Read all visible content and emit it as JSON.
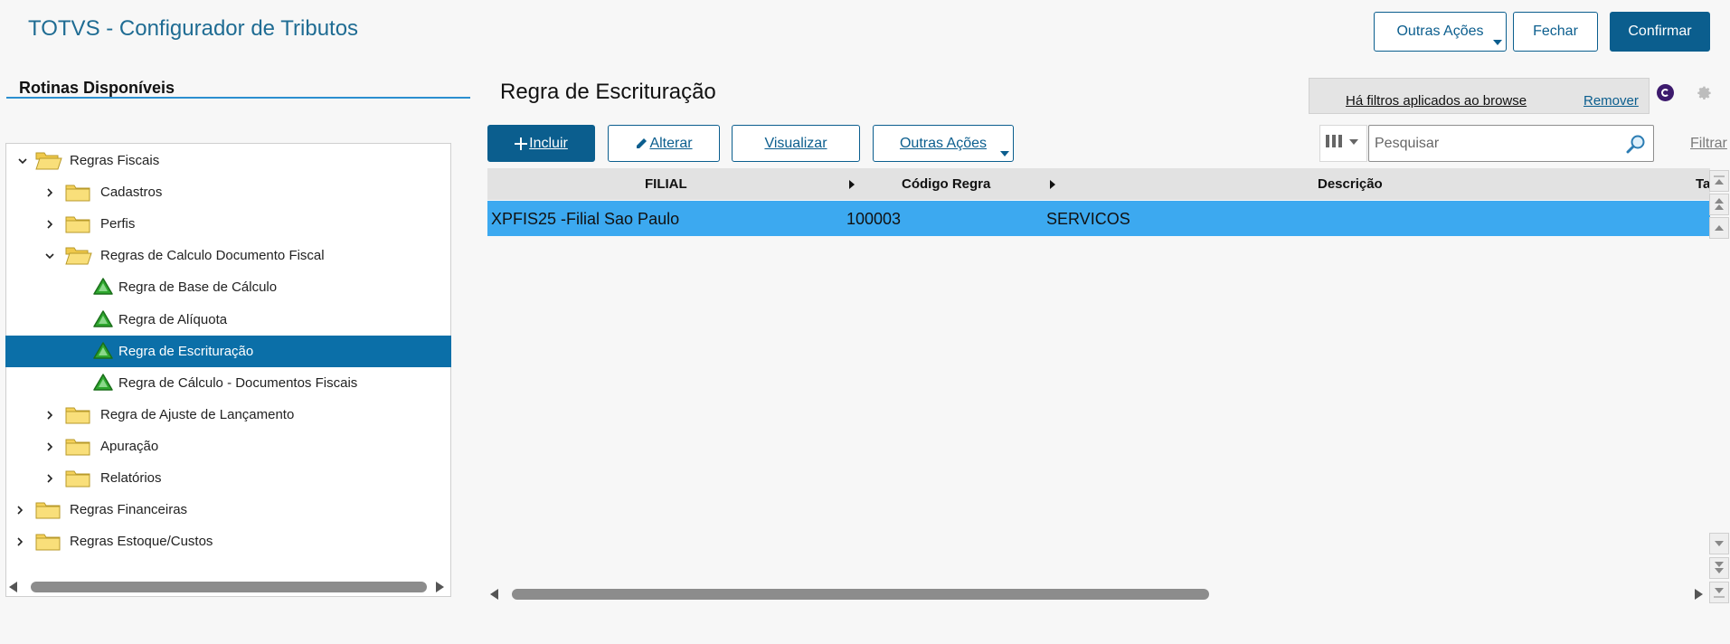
{
  "app": {
    "title": "TOTVS - Configurador de Tributos",
    "buttons": {
      "outras_acoes": "Outras Ações",
      "fechar": "Fechar",
      "confirmar": "Confirmar"
    }
  },
  "sidebar": {
    "title": "Rotinas Disponíveis",
    "tree": [
      {
        "label": "Regras Fiscais",
        "type": "folder",
        "state": "expanded"
      },
      {
        "label": "Cadastros",
        "type": "folder",
        "state": "collapsed"
      },
      {
        "label": "Perfis",
        "type": "folder",
        "state": "collapsed"
      },
      {
        "label": "Regras de Calculo Documento Fiscal",
        "type": "folder",
        "state": "expanded"
      },
      {
        "label": "Regra de Base de Cálculo",
        "type": "routine",
        "state": "leaf"
      },
      {
        "label": "Regra de Alíquota",
        "type": "routine",
        "state": "leaf"
      },
      {
        "label": "Regra de Escrituração",
        "type": "routine",
        "state": "selected"
      },
      {
        "label": "Regra de Cálculo - Documentos Fiscais",
        "type": "routine",
        "state": "leaf"
      },
      {
        "label": "Regra de Ajuste de Lançamento",
        "type": "folder",
        "state": "collapsed"
      },
      {
        "label": "Apuração",
        "type": "folder",
        "state": "collapsed"
      },
      {
        "label": "Relatórios",
        "type": "folder",
        "state": "collapsed"
      },
      {
        "label": "Regras Financeiras",
        "type": "folder",
        "state": "collapsed"
      },
      {
        "label": "Regras Estoque/Custos",
        "type": "folder",
        "state": "collapsed"
      }
    ]
  },
  "main": {
    "title": "Regra de Escrituração",
    "filter_notice": "Há filtros aplicados ao browse",
    "remove_label": "Remover",
    "actions": {
      "incluir": "Incluir",
      "alterar": "Alterar",
      "visualizar": "Visualizar",
      "outras_acoes": "Outras Ações"
    },
    "search": {
      "placeholder": "Pesquisar",
      "value": ""
    },
    "filter_label": "Filtrar",
    "grid": {
      "columns": [
        "FILIAL",
        "Código Regra",
        "Descrição",
        "Ta"
      ],
      "rows": [
        [
          "XPFIS25 -Filial Sao Paulo",
          "100003",
          "SERVICOS",
          ""
        ]
      ]
    }
  },
  "colors": {
    "accent": "#0b5e8e",
    "selected_tree_row": "#0b6fa8",
    "selected_grid_row": "#3ca9f0",
    "folder": "#f5d15a",
    "routine_icon": "#2ea72e"
  },
  "icons": [
    "folder-icon",
    "folder-open-icon",
    "routine-icon",
    "chevron-right-icon",
    "chevron-down-icon",
    "search-icon",
    "gear-icon",
    "columns-icon",
    "pencil-icon",
    "plus-icon"
  ]
}
